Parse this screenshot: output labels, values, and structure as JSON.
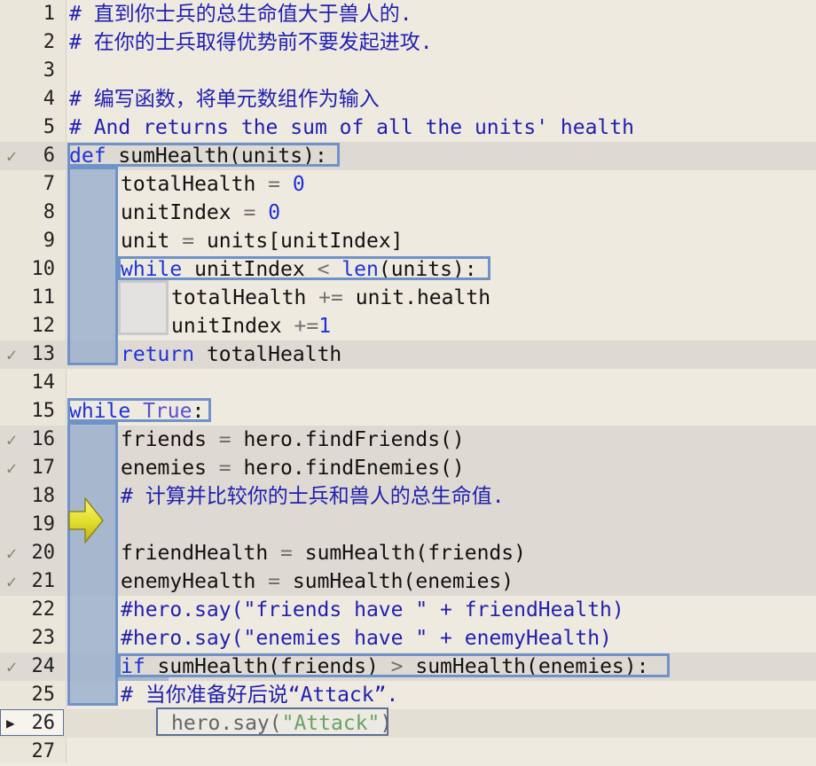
{
  "editor": {
    "lines": [
      {
        "n": "1",
        "text": "# 直到你士兵的总生命值大于兽人的."
      },
      {
        "n": "2",
        "text": "# 在你的士兵取得优势前不要发起进攻."
      },
      {
        "n": "3",
        "text": ""
      },
      {
        "n": "4",
        "text": "# 编写函数，将单元数组作为输入"
      },
      {
        "n": "5",
        "text": "# And returns the sum of all the units' health"
      },
      {
        "n": "6",
        "text": "def sumHealth(units):"
      },
      {
        "n": "7",
        "text": "totalHealth = 0"
      },
      {
        "n": "8",
        "text": "unitIndex = 0"
      },
      {
        "n": "9",
        "text": "unit = units[unitIndex]"
      },
      {
        "n": "10",
        "text": "while unitIndex < len(units):"
      },
      {
        "n": "11",
        "text": "totalHealth += unit.health"
      },
      {
        "n": "12",
        "text": "unitIndex +=1"
      },
      {
        "n": "13",
        "text": "return totalHealth"
      },
      {
        "n": "14",
        "text": ""
      },
      {
        "n": "15",
        "text": "while True:"
      },
      {
        "n": "16",
        "text": "friends = hero.findFriends()"
      },
      {
        "n": "17",
        "text": "enemies = hero.findEnemies()"
      },
      {
        "n": "18",
        "text": "# 计算并比较你的士兵和兽人的总生命值."
      },
      {
        "n": "19",
        "text": ""
      },
      {
        "n": "20",
        "text": "friendHealth = sumHealth(friends)"
      },
      {
        "n": "21",
        "text": "enemyHealth = sumHealth(enemies)"
      },
      {
        "n": "22",
        "text": "#hero.say(\"friends have \" + friendHealth)"
      },
      {
        "n": "23",
        "text": "#hero.say(\"enemies have \" + enemyHealth)"
      },
      {
        "n": "24",
        "text": "if sumHealth(friends) > sumHealth(enemies):"
      },
      {
        "n": "25",
        "text": "# 当你准备好后说“Attack”."
      },
      {
        "n": "26",
        "text": "hero.say(\"Attack\")"
      },
      {
        "n": "27",
        "text": ""
      }
    ],
    "executed_lines": [
      "6",
      "13",
      "16",
      "17",
      "20",
      "21",
      "24"
    ],
    "current_line": "26",
    "icons": {
      "check": "checkmark-icon",
      "current": "play-triangle-icon",
      "pointer": "yellow-arrow-icon"
    },
    "colors": {
      "background": "#efeae0",
      "gutter": "#ebe6da",
      "highlight": "#dedad3",
      "block_fill": "#9db1cc",
      "block_border": "#6f93c8",
      "comment": "#1f1fb0",
      "keyword": "#1d32d8",
      "string": "#1c6e12",
      "arrow": "#e6e23a"
    }
  }
}
